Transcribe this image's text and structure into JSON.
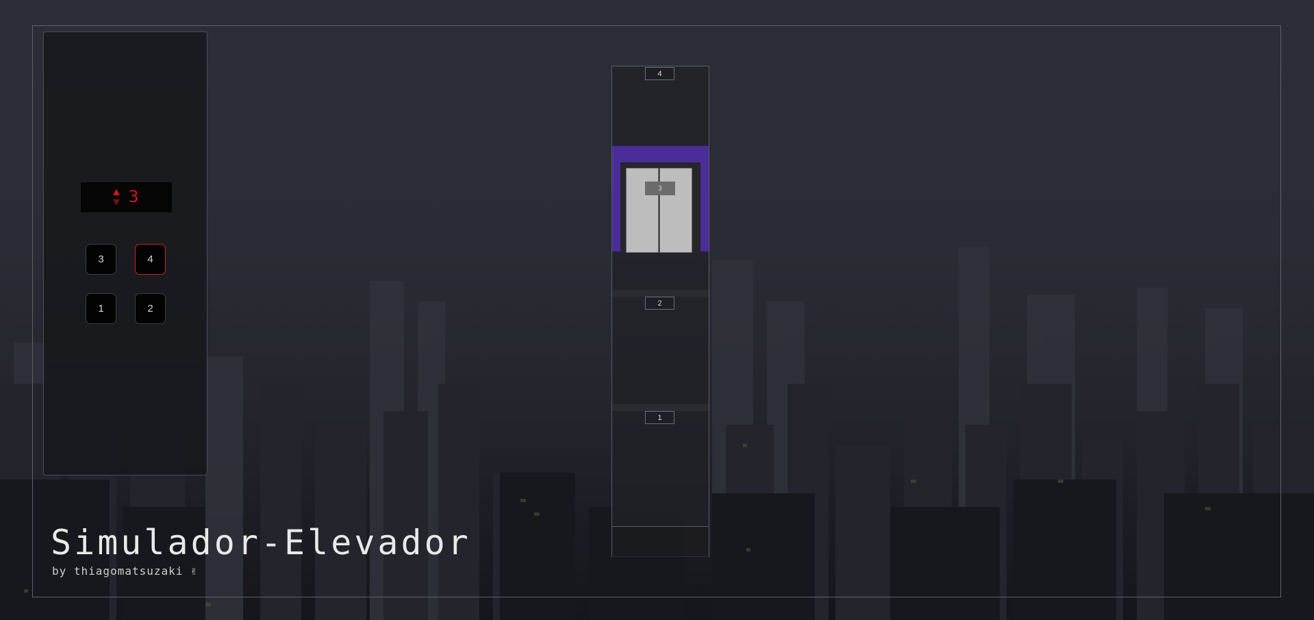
{
  "app": {
    "title": "Simulador-Elevador",
    "byline": "by thiagomatsuzaki ✌"
  },
  "panel": {
    "display": {
      "current_floor": "3",
      "arrow_up_color": "#d21818",
      "arrow_down_color": "#7a1010"
    },
    "buttons": [
      {
        "label": "3",
        "active": false
      },
      {
        "label": "4",
        "active": true
      },
      {
        "label": "1",
        "active": false
      },
      {
        "label": "2",
        "active": false
      }
    ]
  },
  "shaft": {
    "floors": [
      {
        "label": "4"
      },
      {
        "label": "3"
      },
      {
        "label": "2"
      },
      {
        "label": "1"
      }
    ],
    "cabin": {
      "floor_label": "3",
      "background_color": "#4b2d99"
    }
  }
}
